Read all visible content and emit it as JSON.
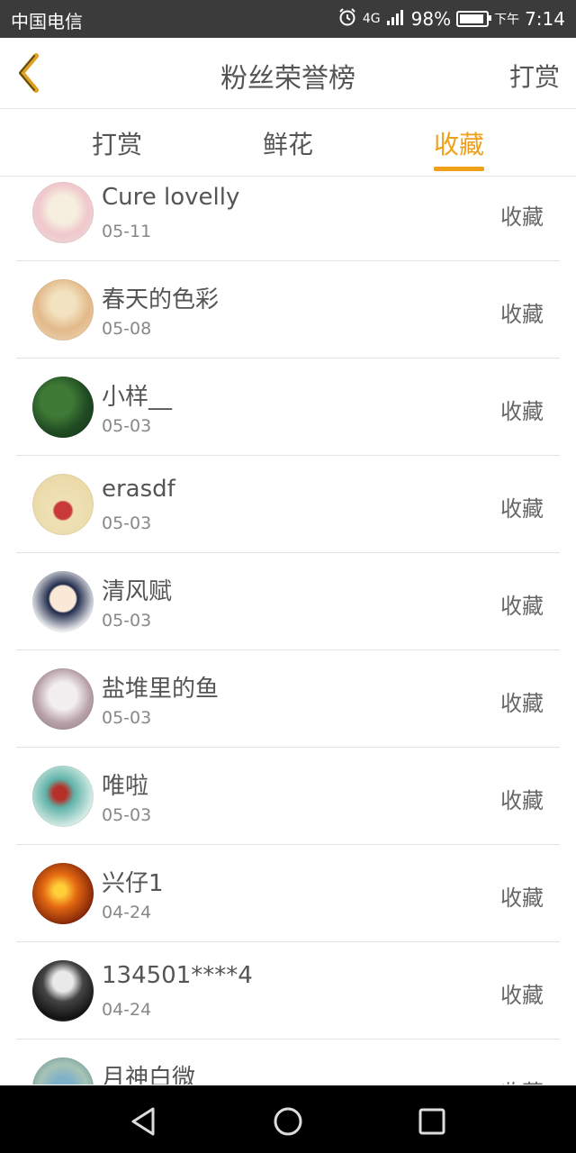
{
  "status_bar": {
    "carrier": "中国电信",
    "network": "4G",
    "battery_percent": "98%",
    "battery_level": 0.98,
    "time_prefix": "下午",
    "time": "7:14"
  },
  "header": {
    "title": "粉丝荣誉榜",
    "right_action": "打赏"
  },
  "tabs": [
    {
      "label": "打赏",
      "active": false
    },
    {
      "label": "鲜花",
      "active": false
    },
    {
      "label": "收藏",
      "active": true
    }
  ],
  "colors": {
    "accent": "#f0a018",
    "text": "#555555",
    "divider": "#e3e3e3"
  },
  "rows": [
    {
      "name": "Cure lovelly",
      "date": "05-11",
      "action": "收藏",
      "avatar": "anime-girl-pink"
    },
    {
      "name": "春天的色彩",
      "date": "05-08",
      "action": "收藏",
      "avatar": "woman-in-dress"
    },
    {
      "name": "小样__",
      "date": "05-03",
      "action": "收藏",
      "avatar": "green-cactus"
    },
    {
      "name": "erasdf",
      "date": "05-03",
      "action": "收藏",
      "avatar": "taurus-cartoon"
    },
    {
      "name": "清风赋",
      "date": "05-03",
      "action": "收藏",
      "avatar": "cartoon-boy-glasses"
    },
    {
      "name": "盐堆里的鱼",
      "date": "05-03",
      "action": "收藏",
      "avatar": "girl-white-dress"
    },
    {
      "name": "唯啦",
      "date": "05-03",
      "action": "收藏",
      "avatar": "teal-painting"
    },
    {
      "name": "兴仔1",
      "date": "04-24",
      "action": "收藏",
      "avatar": "fire-dragon"
    },
    {
      "name": "134501****4",
      "date": "04-24",
      "action": "收藏",
      "avatar": "black-white-portrait"
    },
    {
      "name": "月神白微",
      "date": "",
      "action": "收藏",
      "avatar": "blue-floral"
    }
  ]
}
